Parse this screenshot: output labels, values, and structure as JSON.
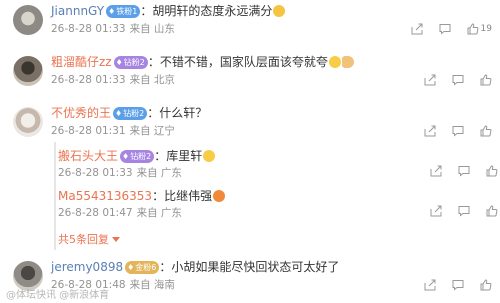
{
  "comments": [
    {
      "nick": "JiannnGY",
      "badge": "铁粉1",
      "text": "胡明轩的态度永远满分",
      "emoji": "grin-emoji",
      "time": "26-8-28 01:33",
      "source": "来自 山东",
      "likes": "19"
    },
    {
      "nick": "粗溜酷仔zz",
      "badge": "钻粉2",
      "text": "不错不错，国家队层面该夸就夸",
      "emoji": "thumbs-up-emoji",
      "time": "26-8-28 01:33",
      "source": "来自 北京",
      "likes": ""
    },
    {
      "nick": "不优秀的王",
      "badge": "钻粉2",
      "text": "什么轩？",
      "time": "26-8-28 01:31",
      "source": "来自 辽宁",
      "likes": ""
    },
    {
      "nick": "jeremy0898",
      "badge": "金粉6",
      "text": "小胡如果能尽快回状态可太好了",
      "time": "26-8-28 01:48",
      "source": "来自 海南",
      "likes": ""
    }
  ],
  "replies": [
    {
      "nick": "搬石头大王",
      "badge": "钻粉2",
      "text": "库里轩",
      "emoji": "smirk-emoji",
      "time": "26-8-28 01:33",
      "source": "来自 广东"
    },
    {
      "nick": "Ma5543136353",
      "text": "比继伟强",
      "emoji": "angry-emoji",
      "time": "26-8-28 01:47",
      "source": "来自 广东"
    }
  ],
  "more_replies": "共5条回复",
  "watermark": "@体坛快讯 @新浪体育"
}
